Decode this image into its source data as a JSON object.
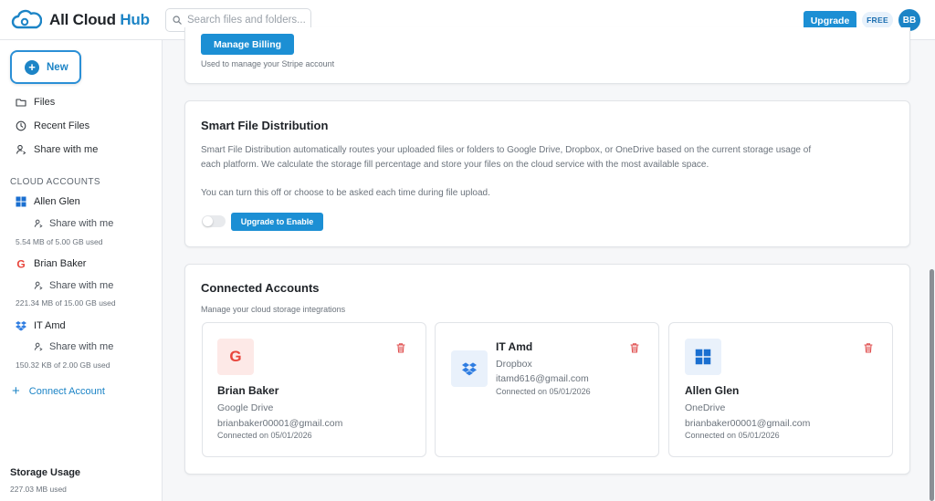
{
  "header": {
    "logo_main": "All Cloud",
    "logo_accent": "Hub",
    "search_placeholder": "Search files and folders...",
    "upgrade_label": "Upgrade",
    "plan_badge": "FREE",
    "avatar_initials": "BB"
  },
  "sidebar": {
    "new_label": "New",
    "nav": [
      {
        "label": "Files",
        "icon": "folder-icon"
      },
      {
        "label": "Recent Files",
        "icon": "clock-icon"
      },
      {
        "label": "Share with me",
        "icon": "person-icon"
      }
    ],
    "section_title": "CLOUD ACCOUNTS",
    "accounts": [
      {
        "name": "Allen Glen",
        "provider_icon": "onedrive-icon",
        "share_label": "Share with me",
        "usage": "5.54 MB of 5.00 GB used"
      },
      {
        "name": "Brian Baker",
        "provider_icon": "google-drive-icon",
        "share_label": "Share with me",
        "usage": "221.34 MB of 15.00 GB used"
      },
      {
        "name": "IT Amd",
        "provider_icon": "dropbox-icon",
        "share_label": "Share with me",
        "usage": "150.32 KB of 2.00 GB used"
      }
    ],
    "connect_label": "Connect Account",
    "storage_title": "Storage Usage",
    "storage_used": "227.03 MB used"
  },
  "billing": {
    "button_label": "Manage Billing",
    "note": "Used to manage your Stripe account"
  },
  "distribution": {
    "title": "Smart File Distribution",
    "description_line1": "Smart File Distribution automatically routes your uploaded files or folders to Google Drive, Dropbox, or OneDrive based on the current storage usage of",
    "description_line2": "each platform. We calculate the storage fill percentage and store your files on the cloud service with the most available space.",
    "note": "You can turn this off or choose to be asked each time during file upload.",
    "enable_label": "Upgrade to Enable",
    "toggle_on": false
  },
  "connected": {
    "title": "Connected Accounts",
    "subtitle": "Manage your cloud storage integrations",
    "accounts": [
      {
        "name": "Brian Baker",
        "provider": "Google Drive",
        "email": "brianbaker00001@gmail.com",
        "connected": "Connected on 05/01/2026",
        "icon": "google-icon",
        "letter": "G"
      },
      {
        "name": "IT Amd",
        "provider": "Dropbox",
        "email": "itamd616@gmail.com",
        "connected": "Connected on 05/01/2026",
        "icon": "dropbox-icon"
      },
      {
        "name": "Allen Glen",
        "provider": "OneDrive",
        "email": "brianbaker00001@gmail.com",
        "connected": "Connected on 05/01/2026",
        "icon": "windows-icon"
      }
    ]
  },
  "colors": {
    "accent": "#1c84c6",
    "button": "#1c8fd4",
    "google_red": "#e8453c",
    "delete_red": "#e05050"
  }
}
